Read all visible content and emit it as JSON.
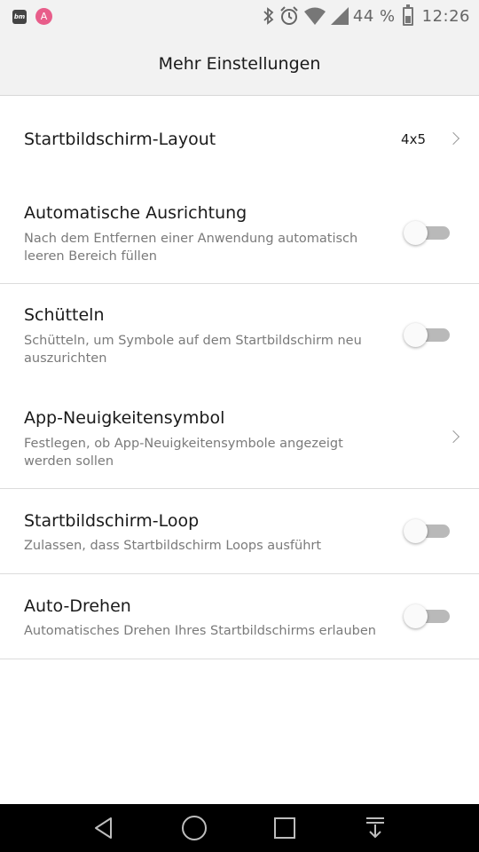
{
  "status_bar": {
    "notif_bm_label": "bm",
    "notif_a_label": "A",
    "battery_text": "44 %",
    "battery_level": 0.44,
    "time": "12:26",
    "icons": [
      "bluetooth-icon",
      "alarm-icon",
      "wifi-icon",
      "signal-icon",
      "battery-icon"
    ]
  },
  "header": {
    "title": "Mehr Einstellungen"
  },
  "settings": {
    "layout": {
      "label": "Startbildschirm-Layout",
      "value": "4x5"
    },
    "auto_align": {
      "label": "Automatische Ausrichtung",
      "desc": "Nach dem Entfernen einer Anwendung automatisch leeren Bereich füllen",
      "enabled": false
    },
    "shake": {
      "label": "Schütteln",
      "desc": "Schütteln, um Symbole auf dem Startbildschirm neu auszurichten",
      "enabled": false
    },
    "badge": {
      "label": "App-Neuigkeitensymbol",
      "desc": "Festlegen, ob App-Neuigkeitensymbole angezeigt werden sollen"
    },
    "loop": {
      "label": "Startbildschirm-Loop",
      "desc": "Zulassen, dass Startbildschirm Loops ausführt",
      "enabled": false
    },
    "auto_rotate": {
      "label": "Auto-Drehen",
      "desc": "Automatisches Drehen Ihres Startbildschirms erlauben",
      "enabled": false
    }
  },
  "nav_bar": {
    "buttons": [
      "back-icon",
      "home-icon",
      "recents-icon",
      "notification-pull-icon"
    ]
  },
  "colors": {
    "bar_background": "#f2f2f2",
    "toggle_track_off": "#b9b9b9",
    "nav_background": "#000000"
  }
}
